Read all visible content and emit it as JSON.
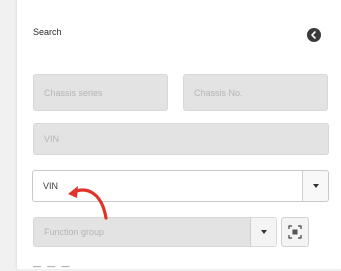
{
  "panel": {
    "title": "Search",
    "toggle_icon": "circle-chevron-icon"
  },
  "fields": {
    "chassis_series": {
      "placeholder": "Chassis series"
    },
    "chassis_no": {
      "placeholder": "Chassis No."
    },
    "vin": {
      "placeholder": "VIN"
    },
    "search_type": {
      "value": "VIN",
      "dropdown_icon": "chevron-down-icon"
    },
    "function_group": {
      "placeholder": "Function group",
      "dropdown_icon": "chevron-down-icon",
      "scan_icon": "scan-icon"
    }
  },
  "annotation": {
    "color": "#e0342b",
    "icon": "curved-arrow-icon"
  }
}
